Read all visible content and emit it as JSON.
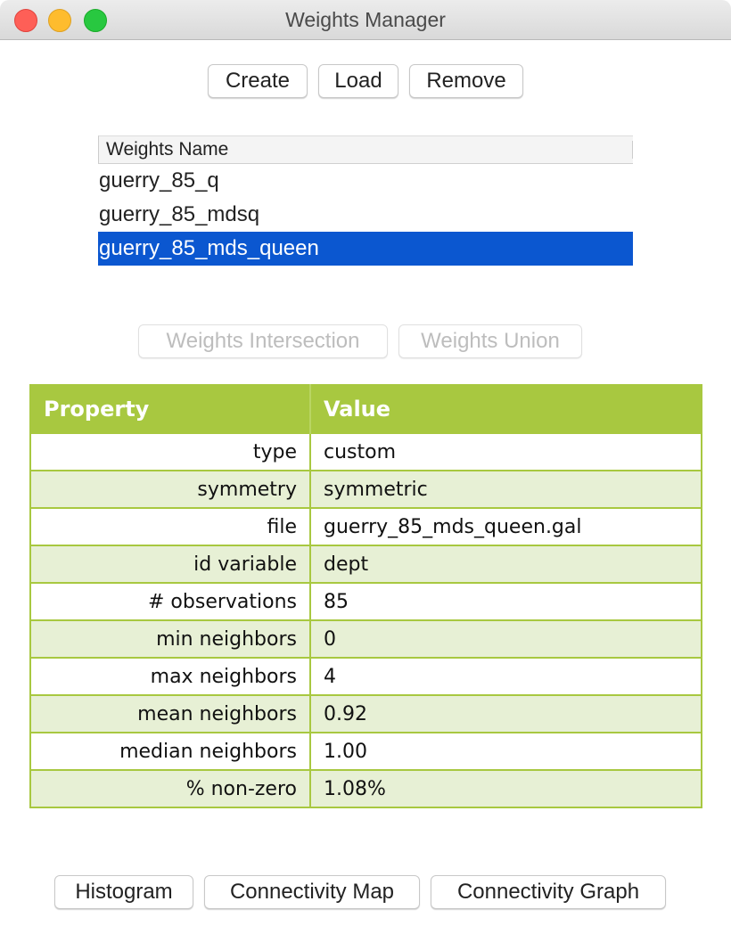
{
  "window": {
    "title": "Weights Manager",
    "traffic_lights": [
      "close",
      "minimize",
      "maximize"
    ]
  },
  "toolbar": {
    "create_label": "Create",
    "load_label": "Load",
    "remove_label": "Remove"
  },
  "weights_list": {
    "header": "Weights Name",
    "items": [
      {
        "label": "guerry_85_q",
        "selected": false
      },
      {
        "label": "guerry_85_mdsq",
        "selected": false
      },
      {
        "label": "guerry_85_mds_queen",
        "selected": true
      }
    ]
  },
  "set_ops": {
    "intersection_label": "Weights Intersection",
    "union_label": "Weights Union",
    "enabled": false
  },
  "properties": {
    "headers": {
      "property": "Property",
      "value": "Value"
    },
    "rows": [
      {
        "property": "type",
        "value": "custom"
      },
      {
        "property": "symmetry",
        "value": "symmetric"
      },
      {
        "property": "file",
        "value": "guerry_85_mds_queen.gal"
      },
      {
        "property": "id variable",
        "value": "dept"
      },
      {
        "property": "# observations",
        "value": "85"
      },
      {
        "property": "min neighbors",
        "value": "0"
      },
      {
        "property": "max neighbors",
        "value": "4"
      },
      {
        "property": "mean neighbors",
        "value": "0.92"
      },
      {
        "property": "median neighbors",
        "value": "1.00"
      },
      {
        "property": "% non-zero",
        "value": "1.08%"
      }
    ],
    "header_color": "#a8c840",
    "alt_row_color": "#e7f0d5"
  },
  "bottom_buttons": {
    "histogram_label": "Histogram",
    "connectivity_map_label": "Connectivity Map",
    "connectivity_graph_label": "Connectivity Graph"
  },
  "colors": {
    "selection": "#0b57d0"
  }
}
